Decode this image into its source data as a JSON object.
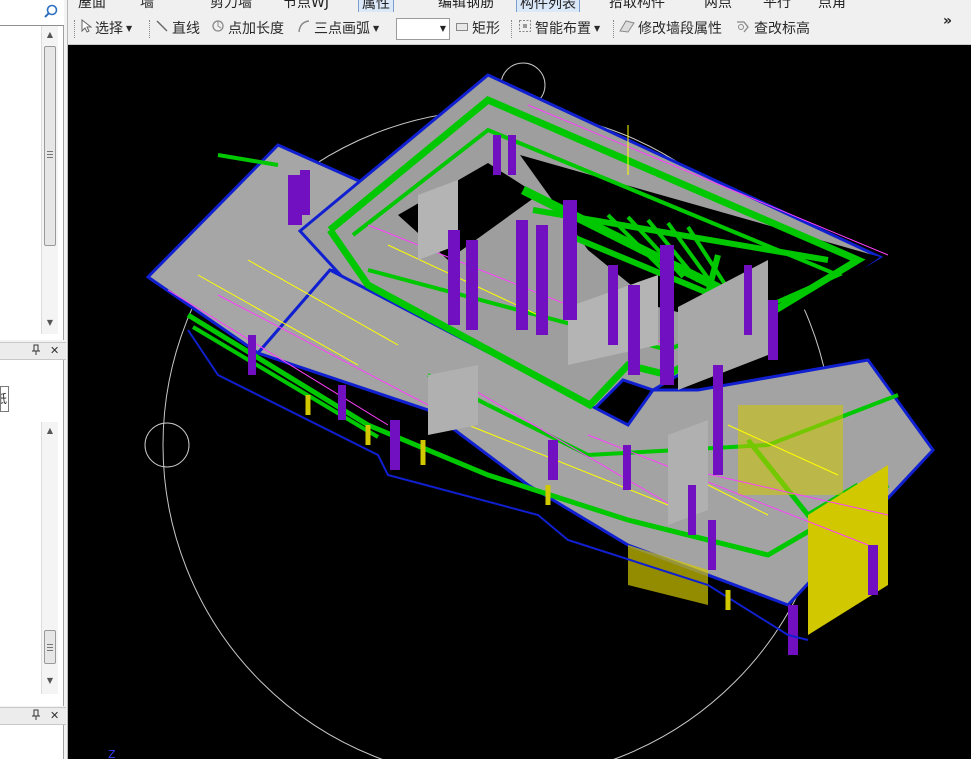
{
  "top_strip": {
    "tabs": [
      "屋面",
      "墙",
      "剪力墙",
      "节点WJ"
    ],
    "buttons": [
      "属性",
      "编辑钢筋",
      "构件列表",
      "拾取构件",
      "两点",
      "平行",
      "点角"
    ]
  },
  "toolbar": {
    "select": "选择",
    "line": "直线",
    "point_length": "点加长度",
    "three_point_arc": "三点画弧",
    "combo_value": "",
    "rectangle": "矩形",
    "smart_layout": "智能布置",
    "modify_wall_segment": "修改墙段属性",
    "check_elevation": "查改标高",
    "overflow": "»"
  },
  "left_panel": {
    "tree_input_value": "纸"
  },
  "viewport": {
    "axis_label": "Z"
  },
  "colors": {
    "background": "#000000",
    "wall_fill": "#a6a6a6",
    "beam": "#00c800",
    "column": "#7010c0",
    "edge": "#1020d0",
    "rebar_yellow": "#ffff00",
    "rebar_magenta": "#ff40ff",
    "orbit_circle": "#c8c8c8",
    "yellow_panel": "#d2c800"
  },
  "icons": [
    "search-icon",
    "pin-icon",
    "close-icon",
    "select-arrow-icon",
    "line-icon",
    "point-length-icon",
    "arc-icon",
    "rectangle-icon",
    "smart-layout-icon",
    "modify-wall-icon",
    "elevation-icon"
  ]
}
